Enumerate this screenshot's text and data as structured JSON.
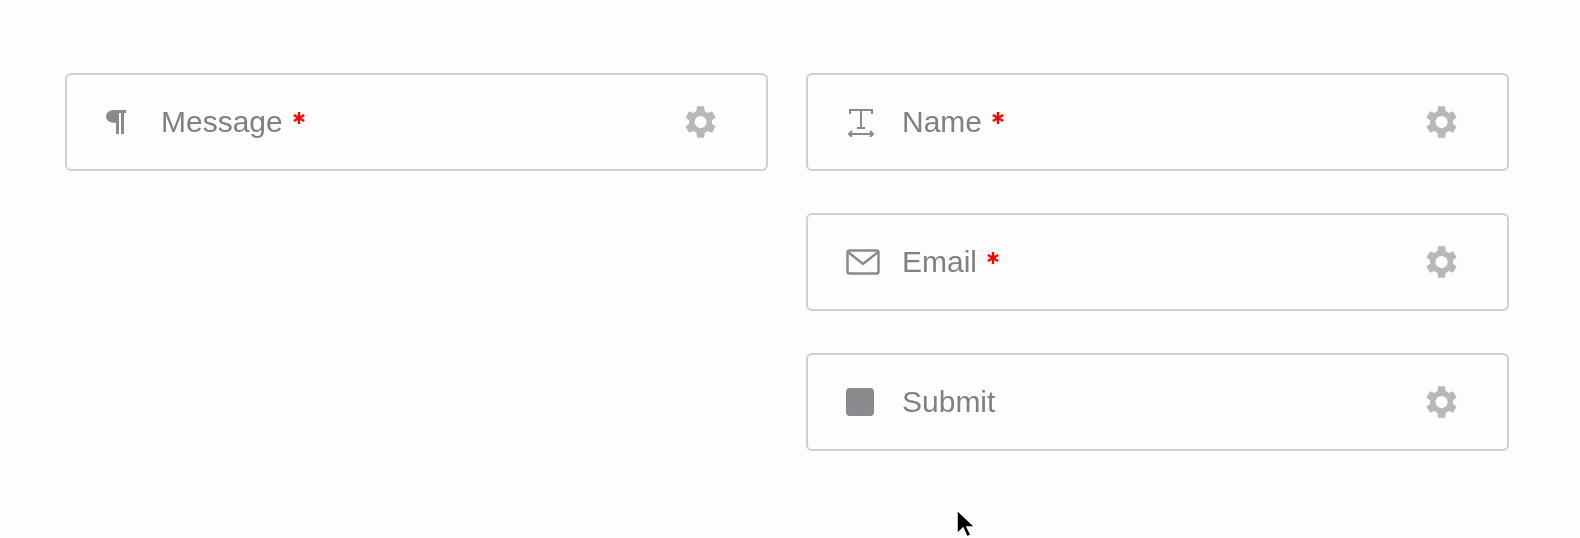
{
  "columns": [
    {
      "fields": [
        {
          "kind": "paragraph",
          "label": "Message",
          "required": true
        }
      ]
    },
    {
      "fields": [
        {
          "kind": "text",
          "label": "Name",
          "required": true
        },
        {
          "kind": "email",
          "label": "Email",
          "required": true
        },
        {
          "kind": "button",
          "label": "Submit",
          "required": false
        }
      ]
    }
  ]
}
